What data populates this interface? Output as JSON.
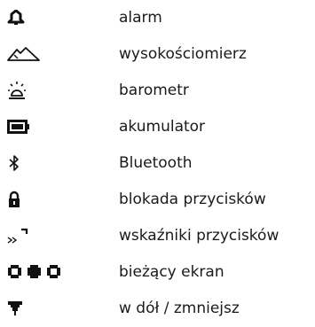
{
  "legend": {
    "items": [
      {
        "icon": "alarm-bell-icon",
        "label": "alarm"
      },
      {
        "icon": "altimeter-mountain-icon",
        "label": "wysokościomierz"
      },
      {
        "icon": "barometer-weather-icon",
        "label": "barometr"
      },
      {
        "icon": "battery-icon",
        "label": "akumulator"
      },
      {
        "icon": "bluetooth-icon",
        "label": "Bluetooth"
      },
      {
        "icon": "padlock-icon",
        "label": "blokada przycisków"
      },
      {
        "icon": "button-indicator-arrows-icon",
        "label": "wskaźniki przycisków"
      },
      {
        "icon": "current-screen-dots-icon",
        "label": "bieżący ekran"
      },
      {
        "icon": "down-decrease-arrow-icon",
        "label": "w dół / zmniejsz"
      }
    ]
  }
}
